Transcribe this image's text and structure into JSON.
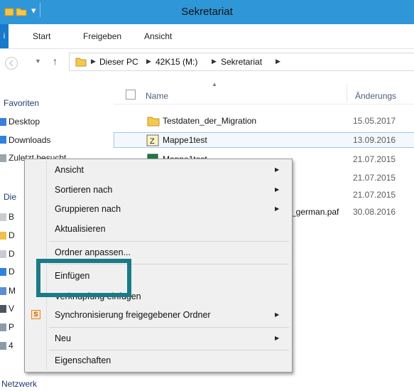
{
  "window": {
    "title": "Sekretariat",
    "accent": "#2f96d8"
  },
  "ribbon": {
    "file_tab": "i",
    "tabs": [
      "Start",
      "Freigeben",
      "Ansicht"
    ]
  },
  "address": {
    "crumbs": [
      "Dieser PC",
      "42K15 (M:)",
      "Sekretariat"
    ]
  },
  "nav": {
    "items": [
      {
        "label": "Favoriten",
        "icon": "none"
      },
      {
        "label": "Desktop",
        "icon": "desktop-icon"
      },
      {
        "label": "Downloads",
        "icon": "downloads-icon"
      },
      {
        "label": "Zuletzt besucht",
        "icon": "recent-icon"
      },
      {
        "label": "Die",
        "icon": "none"
      },
      {
        "label": "B",
        "icon": "file-icon"
      },
      {
        "label": "D",
        "icon": "folder-icon"
      },
      {
        "label": "D",
        "icon": "file-icon"
      },
      {
        "label": "D",
        "icon": "downloads-icon"
      },
      {
        "label": "M",
        "icon": "music-icon"
      },
      {
        "label": "V",
        "icon": "video-icon"
      },
      {
        "label": "P",
        "icon": "drive-icon"
      },
      {
        "label": "4",
        "icon": "drive-icon"
      },
      {
        "label": "Netzwerk",
        "icon": "none"
      }
    ]
  },
  "columns": {
    "name": "Name",
    "date": "Änderungs"
  },
  "files": [
    {
      "name": "Testdaten_der_Migration",
      "date": "15.05.2017",
      "icon": "folder-icon"
    },
    {
      "name": "Mappe1test",
      "date": "13.09.2016",
      "icon": "project-icon"
    },
    {
      "name": "Mappe1test",
      "date": "21.07.2015",
      "icon": "excel-icon"
    },
    {
      "name": "",
      "date": "21.07.2015",
      "icon": "none"
    },
    {
      "name": "",
      "date": "21.07.2015",
      "icon": "none"
    },
    {
      "name": "_german.paf",
      "date": "30.08.2016",
      "icon": "none"
    }
  ],
  "context_menu": {
    "items": [
      {
        "label": "Ansicht",
        "submenu": true
      },
      {
        "label": "Sortieren nach",
        "submenu": true
      },
      {
        "label": "Gruppieren nach",
        "submenu": true
      },
      {
        "label": "Aktualisieren",
        "submenu": false
      },
      {
        "label": "Ordner anpassen...",
        "submenu": false
      },
      {
        "label": "Einfügen",
        "submenu": false
      },
      {
        "label": "Verknüpfung einfügen",
        "submenu": false
      },
      {
        "label": "Synchronisierung freigegebener Ordner",
        "submenu": true,
        "icon": "sync-icon"
      },
      {
        "label": "Neu",
        "submenu": true
      },
      {
        "label": "Eigenschaften",
        "submenu": false
      }
    ],
    "highlight_color": "#1a7b87"
  }
}
